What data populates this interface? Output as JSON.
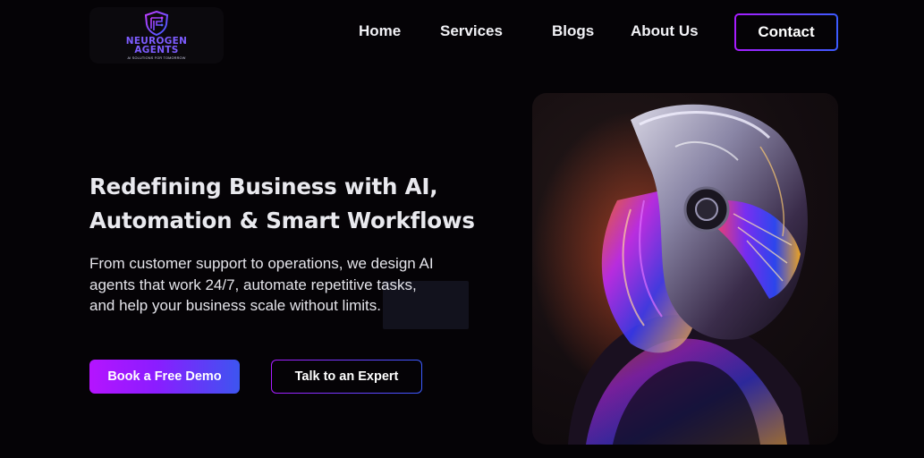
{
  "brand": {
    "name_line1": "NEUROGEN",
    "name_line2": "AGENTS",
    "tagline": "AI SOLUTIONS FOR TOMORROW",
    "logo_icon": "shield-brain-icon",
    "colors": {
      "primary": "#7d5cff",
      "accent": "#a81cff",
      "blue": "#3b5bff"
    }
  },
  "nav": {
    "home": "Home",
    "services": "Services",
    "blogs": "Blogs",
    "about": "About Us",
    "contact": "Contact"
  },
  "hero": {
    "title_line1": "Redefining Business with AI,",
    "title_line2": "Automation & Smart Workflows",
    "description": "From customer support to operations, we design AI agents that work 24/7, automate repetitive tasks, and help your business scale without limits.",
    "primary_cta": "Book a Free Demo",
    "secondary_cta": "Talk to an Expert",
    "image": "futuristic-robot-helmet-image"
  },
  "colors": {
    "background": "#050306",
    "gradient_start": "#b514ff",
    "gradient_end": "#3d55f0"
  }
}
